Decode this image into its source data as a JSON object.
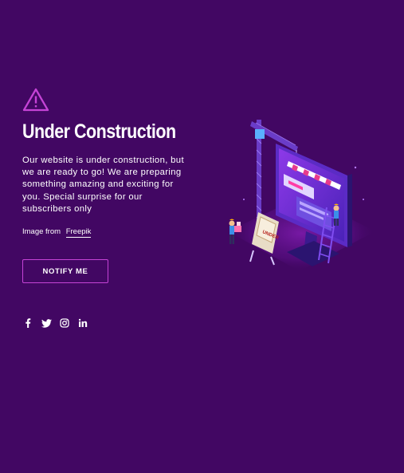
{
  "colors": {
    "background": "#420763",
    "accent": "#c543d6",
    "text": "#ffffff"
  },
  "hero": {
    "icon": "warning-triangle-icon",
    "title": "Under Construction",
    "description": "Our website is under construction, but we are ready to go! We are preparing something amazing and exciting for you. Special surprise for our subscribers only",
    "credit_prefix": "Image from",
    "credit_link": "Freepik"
  },
  "actions": {
    "notify_label": "NOTIFY ME"
  },
  "social": [
    "facebook-icon",
    "twitter-icon",
    "instagram-icon",
    "linkedin-icon"
  ],
  "illustration": {
    "sign_text": "UNDER"
  }
}
